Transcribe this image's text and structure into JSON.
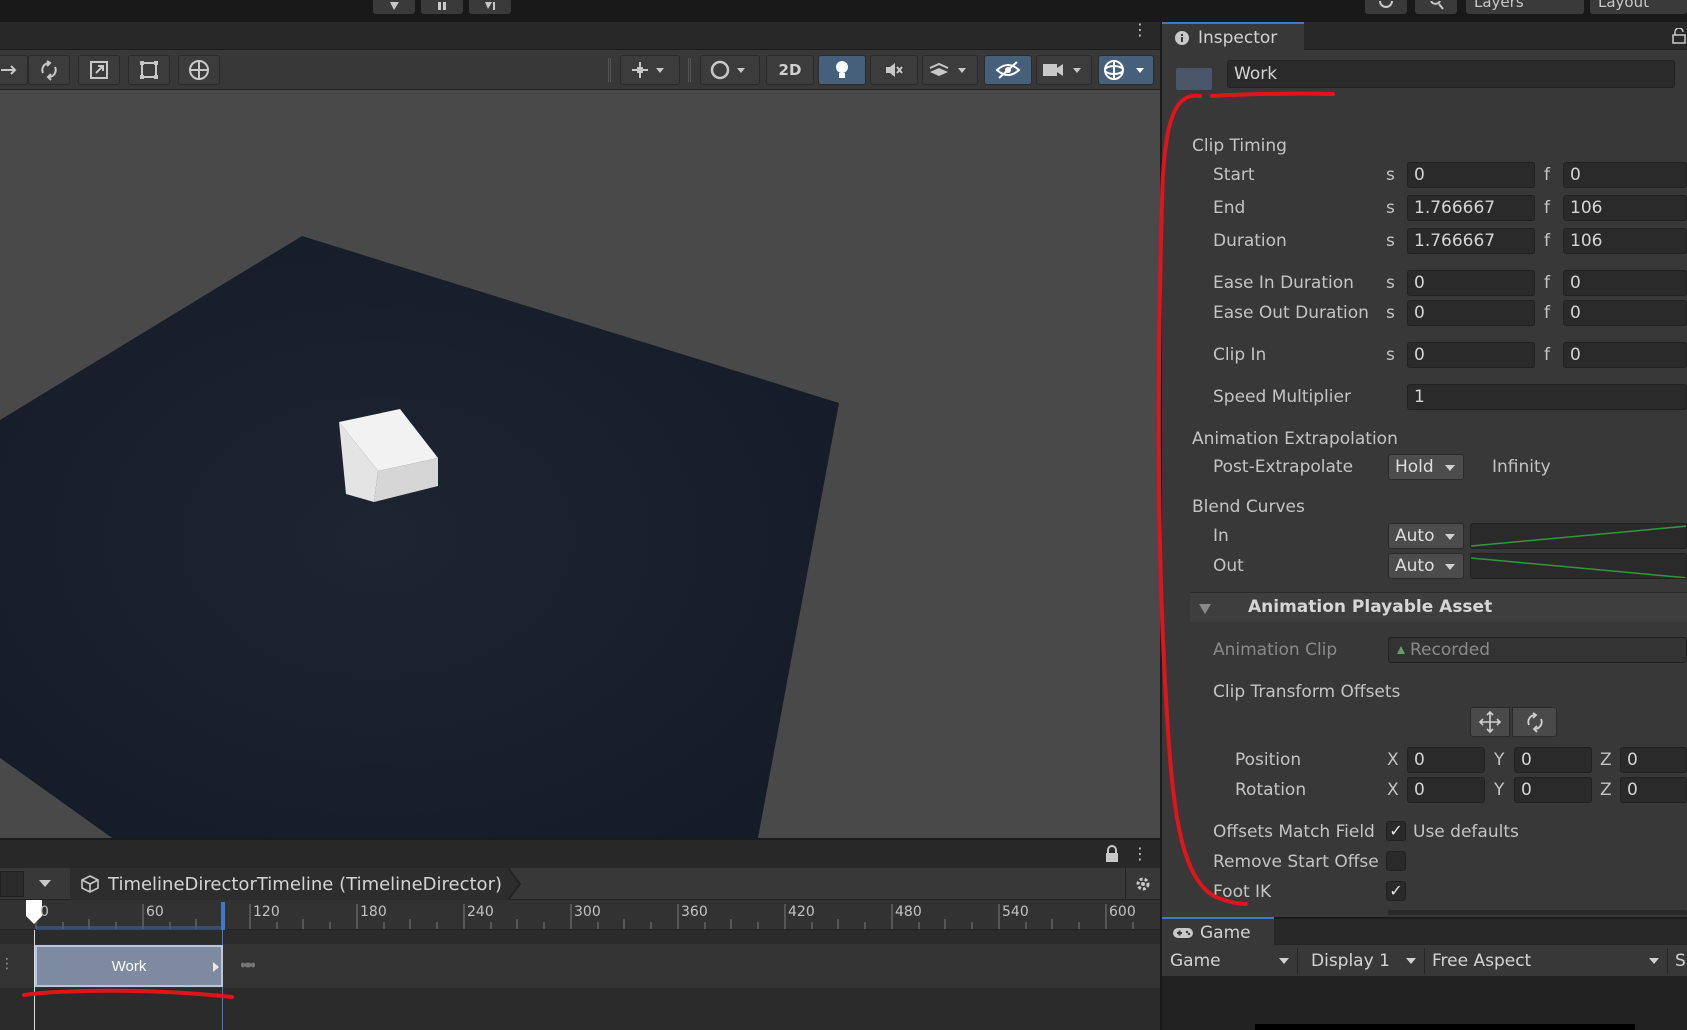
{
  "topbar": {
    "layers_label": "Layers",
    "layout_label": "Layout"
  },
  "scene": {
    "toolbar": {
      "mode_2d_label": "2D"
    }
  },
  "timeline": {
    "asset_label": "TimelineDirectorTimeline (TimelineDirector)",
    "ruler_ticks": [
      "0",
      "60",
      "120",
      "180",
      "240",
      "300",
      "360",
      "420",
      "480",
      "540",
      "600"
    ],
    "clip_label": "Work"
  },
  "inspector": {
    "tab_label": "Inspector",
    "name_value": "Work",
    "clip_timing": {
      "heading": "Clip Timing",
      "seconds_unit": "s",
      "frames_unit": "f",
      "rows": [
        {
          "label": "Start",
          "seconds": "0",
          "frames": "0"
        },
        {
          "label": "End",
          "seconds": "1.766667",
          "frames": "106"
        },
        {
          "label": "Duration",
          "seconds": "1.766667",
          "frames": "106"
        },
        {
          "label": "Ease In Duration",
          "seconds": "0",
          "frames": "0"
        },
        {
          "label": "Ease Out Duration",
          "seconds": "0",
          "frames": "0"
        },
        {
          "label": "Clip In",
          "seconds": "0",
          "frames": "0"
        }
      ],
      "speed_label": "Speed Multiplier",
      "speed_value": "1"
    },
    "extrapolation": {
      "heading": "Animation Extrapolation",
      "post_label": "Post-Extrapolate",
      "post_value": "Hold",
      "post_extra": "Infinity"
    },
    "blend_curves": {
      "heading": "Blend Curves",
      "in_label": "In",
      "in_value": "Auto",
      "out_label": "Out",
      "out_value": "Auto"
    },
    "playable_asset": {
      "heading": "Animation Playable Asset",
      "clip_label": "Animation Clip",
      "clip_value": "Recorded",
      "offsets_label": "Clip Transform Offsets",
      "position_label": "Position",
      "rotation_label": "Rotation",
      "axis_x": "X",
      "axis_y": "Y",
      "axis_z": "Z",
      "position": {
        "x": "0",
        "y": "0",
        "z": "0"
      },
      "rotation": {
        "x": "0",
        "y": "0",
        "z": "0"
      },
      "match_fields_label": "Offsets Match Field",
      "match_fields_checked": true,
      "use_defaults_label": "Use defaults",
      "remove_start_label": "Remove Start Offse",
      "remove_start_checked": false,
      "foot_ik_label": "Foot IK",
      "foot_ik_checked": true
    }
  },
  "game": {
    "tab_label": "Game",
    "view_dropdown": "Game",
    "display_dropdown": "Display 1",
    "aspect_dropdown": "Free Aspect",
    "extra": "S"
  },
  "colors": {
    "accent": "#3f79c6",
    "annotation": "#e0141b",
    "clip": "#7d8aa0"
  }
}
